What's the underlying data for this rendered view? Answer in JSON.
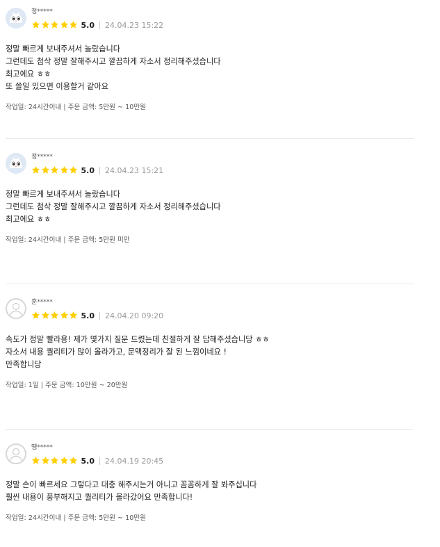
{
  "reviews": [
    {
      "author": "정*****",
      "avatar_icon": "cat-face-icon",
      "rating": 5,
      "score_label": "5.0",
      "date": "24.04.23 15:22",
      "lines": [
        "정말 빠르게 보내주셔서 놀랐습니다",
        "그런데도 첨삭 정말 잘해주시고 깔끔하게 자소서 정리해주셨습니다",
        "최고에요 ㅎㅎ",
        "또 쓸일 있으면 이용할거 같아요"
      ],
      "info": "작업일: 24시간이내 | 주문 금액: 5만원 ~ 10만원"
    },
    {
      "author": "정*****",
      "avatar_icon": "cat-face-icon",
      "rating": 5,
      "score_label": "5.0",
      "date": "24.04.23 15:21",
      "lines": [
        "정말 빠르게 보내주셔서 놀랐습니다",
        "그런데도 첨삭 정말 잘해주시고 깔끔하게 자소서 정리해주셨습니다",
        "최고에요 ㅎㅎ"
      ],
      "info": "작업일: 24시간이내 | 주문 금액: 5만원 미만"
    },
    {
      "author": "훈*****",
      "avatar_icon": "default-avatar-icon",
      "rating": 5,
      "score_label": "5.0",
      "date": "24.04.20 09:20",
      "lines": [
        "속도가 정말 빨라용! 제가 몇가지 질문 드렸는데 친절하게 잘 답해주셨습니당 ㅎㅎ",
        "자소서 내용 퀄리티가 많이 올라가고, 문맥정리가 잘 된 느낌이네요 !",
        "만족합니당"
      ],
      "info": "작업일: 1일 | 주문 금액: 10만원 ~ 20만원"
    },
    {
      "author": "땡*****",
      "avatar_icon": "default-avatar-icon",
      "rating": 5,
      "score_label": "5.0",
      "date": "24.04.19 20:45",
      "lines": [
        "정말 손이 빠르세요 그렇다고 대충 해주시는거 아니고 꼼꼼하게 잘 봐주십니다",
        "훨씬 내용이 풍부해지고 퀄리티가 올라갔어요 만족합니다!"
      ],
      "info": "작업일: 24시간이내 | 주문 금액: 5만원 ~ 10만원"
    }
  ],
  "colors": {
    "star": "#FFCF02",
    "text": "#222222",
    "muted": "#9A9A9A",
    "divider": "#E6E6E6"
  }
}
